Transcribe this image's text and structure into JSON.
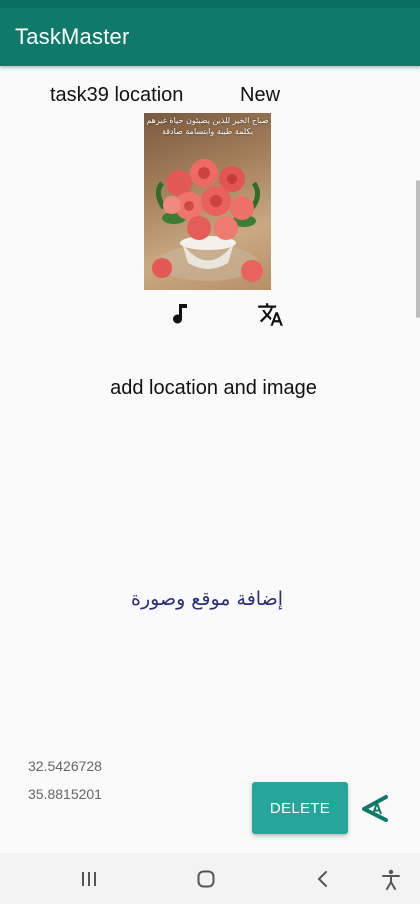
{
  "app": {
    "title": "TaskMaster",
    "accent": "#0f7a69",
    "button_color": "#26a69a"
  },
  "task": {
    "title": "task39 location",
    "state": "New",
    "image_caption": "صباح الخير للذين يضيئون حياة غيرهم بكلمة طيبة وابتسامة صادقة",
    "description_en": "add location and image",
    "description_ar": "إضافة موقع وصورة",
    "latitude": "32.5426728",
    "longitude": "35.8815201"
  },
  "actions": {
    "delete_label": "DELETE"
  },
  "icons": {
    "music": "music-note-icon",
    "translate": "translate-icon",
    "overlay": "overlay-tool-icon"
  },
  "nav": {
    "items": [
      "recents-icon",
      "home-icon",
      "back-icon",
      "accessibility-icon"
    ]
  }
}
